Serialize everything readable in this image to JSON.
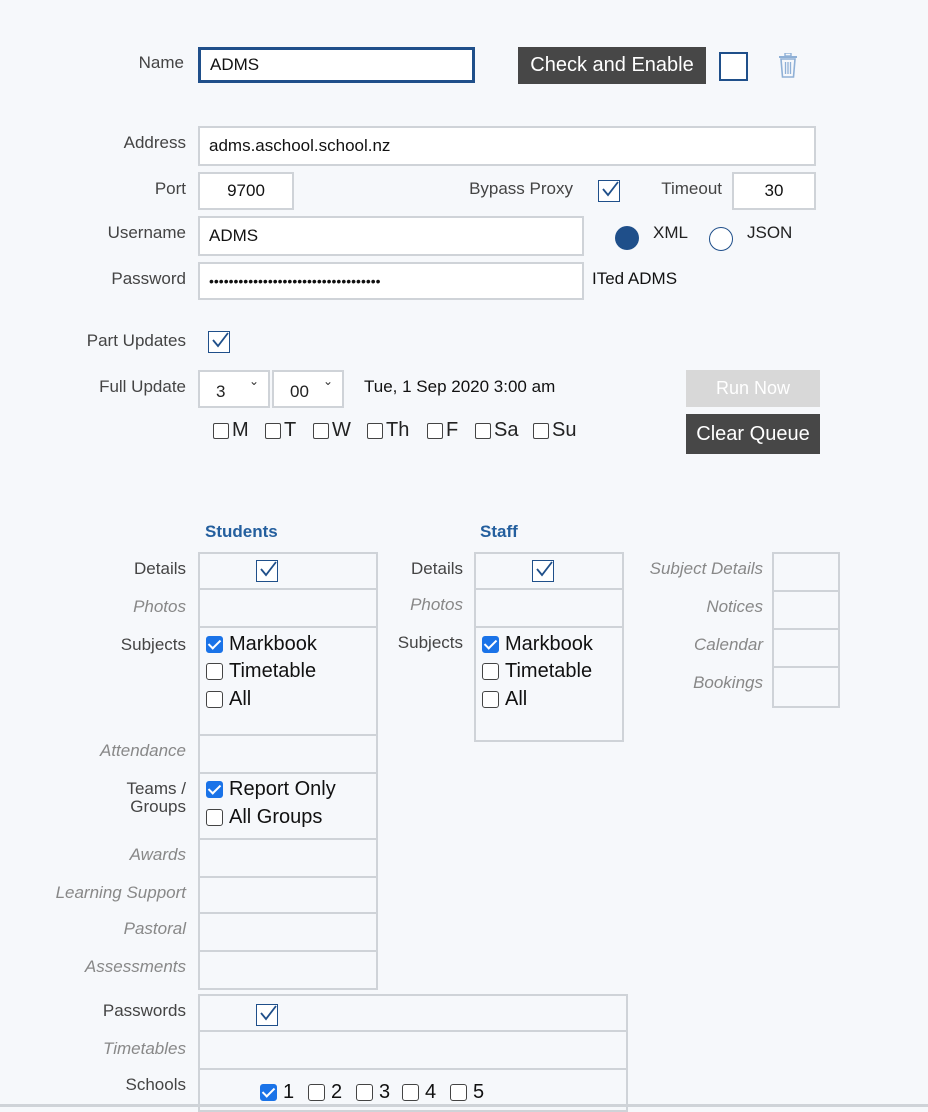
{
  "config": {
    "name_label": "Name",
    "name_value": "ADMS",
    "check_enable_label": "Check and Enable",
    "address_label": "Address",
    "address_value": "adms.aschool.school.nz",
    "port_label": "Port",
    "port_value": "9700",
    "bypass_proxy_label": "Bypass Proxy",
    "timeout_label": "Timeout",
    "timeout_value": "30",
    "username_label": "Username",
    "username_value": "ADMS",
    "format_xml": "XML",
    "format_json": "JSON",
    "password_label": "Password",
    "password_value": "•••••••••••••••••••••••••••••••••••",
    "password_hint": "ITed ADMS"
  },
  "schedule": {
    "part_updates_label": "Part Updates",
    "full_update_label": "Full Update",
    "hour": "3",
    "minute": "00",
    "next_run": "Tue, 1 Sep 2020 3:00 am",
    "run_now_label": "Run Now",
    "clear_queue_label": "Clear Queue",
    "days": [
      "M",
      "T",
      "W",
      "Th",
      "F",
      "Sa",
      "Su"
    ]
  },
  "students": {
    "header": "Students",
    "details": "Details",
    "photos": "Photos",
    "subjects": "Subjects",
    "subject_opts": [
      "Markbook",
      "Timetable",
      "All"
    ],
    "attendance": "Attendance",
    "teams_l1": "Teams /",
    "teams_l2": "Groups",
    "team_opts": [
      "Report Only",
      "All Groups"
    ],
    "awards": "Awards",
    "learning_support": "Learning Support",
    "pastoral": "Pastoral",
    "assessments": "Assessments"
  },
  "staff": {
    "header": "Staff",
    "details": "Details",
    "photos": "Photos",
    "subjects": "Subjects",
    "subject_opts": [
      "Markbook",
      "Timetable",
      "All"
    ]
  },
  "other": {
    "subject_details": "Subject Details",
    "notices": "Notices",
    "calendar": "Calendar",
    "bookings": "Bookings"
  },
  "misc": {
    "passwords": "Passwords",
    "timetables": "Timetables",
    "schools": "Schools",
    "school_nums": [
      "1",
      "2",
      "3",
      "4",
      "5"
    ]
  },
  "colors": {
    "accent": "#1f4f8a",
    "header_blue": "#245f9e",
    "dark_button": "#474747",
    "disabled_button": "#d8d8d8",
    "checkbox_blue": "#1a73e8"
  }
}
